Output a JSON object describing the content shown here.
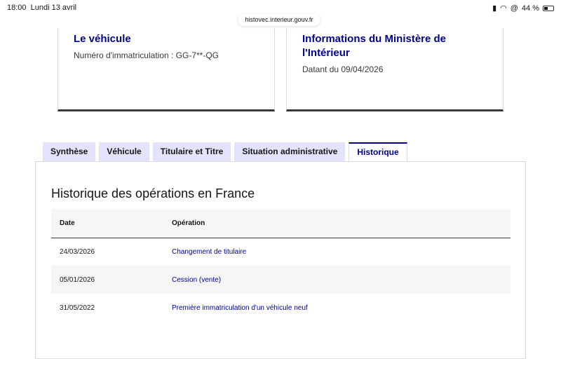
{
  "status": {
    "time": "18:00",
    "date": "Lundi 13 avril",
    "battery": "44 %"
  },
  "url": "histovec.interieur.gouv.fr",
  "cards": [
    {
      "title": "Le véhicule",
      "text": "Numéro d'immatriculation : GG-7**-QG"
    },
    {
      "title": "Informations du Ministère de l'Intérieur",
      "text": "Datant du 09/04/2026"
    }
  ],
  "tabs": [
    "Synthèse",
    "Véhicule",
    "Titulaire et Titre",
    "Situation administrative",
    "Historique"
  ],
  "panel": {
    "title": "Historique des opérations en France",
    "headers": [
      "Date",
      "Opération"
    ],
    "rows": [
      [
        "24/03/2026",
        "Changement de titulaire"
      ],
      [
        "05/01/2026",
        "Cession (vente)"
      ],
      [
        "31/05/2022",
        "Première immatriculation d'un véhicule neuf"
      ]
    ]
  }
}
